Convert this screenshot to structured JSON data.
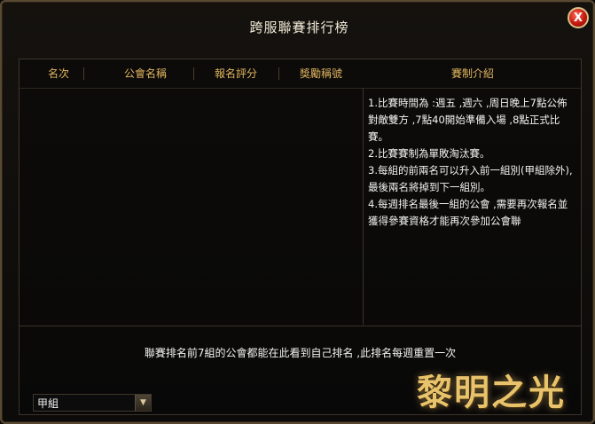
{
  "window": {
    "title": "跨服聯賽排行榜",
    "close_label": "X"
  },
  "table": {
    "columns": [
      "名次",
      "公會名稱",
      "報名評分",
      "獎勵稱號",
      "賽制介紹"
    ],
    "rows": []
  },
  "rules": [
    "1.比賽時間為 :週五 ,週六 ,周日晚上7點公佈對敵雙方 ,7點40開始準備入場 ,8點正式比賽。",
    "2.比賽賽制為單敗淘汰賽。",
    "3.每組的前兩名可以升入前一組別(甲組除外),最後兩名將掉到下一組別。",
    "4.每週排名最後一組的公會 ,需要再次報名並獲得參賽資格才能再次參加公會聯"
  ],
  "notice": "聯賽排名前7組的公會都能在此看到自己排名 ,此排名每週重置一次",
  "group_select": {
    "selected": "甲組"
  },
  "logo_text": "黎明之光"
}
